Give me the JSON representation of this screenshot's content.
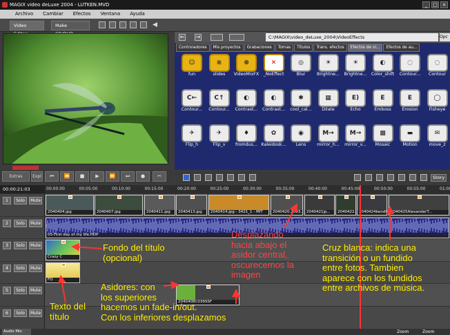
{
  "window": {
    "title": "MAGIX video deLuxe 2004 - LUTKEN.MVD"
  },
  "menu": [
    "Archivo",
    "Cambiar",
    "Efectos",
    "Ventana",
    "Ayuda"
  ],
  "toolbar": {
    "tab_video_editor": "Video Editor",
    "tab_make_cd": "Make CD/DVD"
  },
  "transport": {
    "export_label": "Expl",
    "extras_label": "Extras"
  },
  "browser": {
    "path": "C:\\MAGIX\\video_deLuxe_2004\\VideoEffects",
    "path_suffix": "Opc",
    "tabs": [
      "Controladores",
      "Mis proyectos",
      "Grabaciones",
      "Tomas",
      "Títulos",
      "Trans. efectos",
      "Efectos de vi...",
      "Efectos de au..."
    ],
    "effects": [
      "fun",
      "slides",
      "VideoMixFX",
      "_NoEffect",
      "Blur",
      "Brightne...",
      "Brightne...",
      "Color_shift",
      "Contour...",
      "Contour",
      "Contour...",
      "Contour...",
      "Contrast...",
      "Contrast...",
      "cool_cal...",
      "Dilate",
      "Echo",
      "Emboss",
      "Erosion",
      "Fisheye",
      "Flip_h",
      "Flip_v",
      "fromdus...",
      "Kaleidosk...",
      "Lens",
      "mirror_h...",
      "mirror_v...",
      "Mosaic",
      "Motion",
      "move_z"
    ],
    "story_label": "Story"
  },
  "timeline": {
    "timecode": "00:00:21:03",
    "ruler": [
      "00:00:00",
      "00:05:00",
      "00:10:00",
      "00:15:00",
      "00:20:00",
      "00:25:00",
      "00:30:00",
      "00:35:00",
      "00:40:00",
      "00:45:00",
      "00:50:00",
      "00:55:00",
      "01:00:00"
    ],
    "track_labels": {
      "solo": "Solo",
      "mute": "Mute"
    },
    "tracks": [
      "1",
      "2",
      "3",
      "4",
      "5",
      "6"
    ],
    "clips_track1": [
      "2040404.jpg",
      "2040407.jpg",
      "2040411.jpg",
      "2040413.jpg",
      "2040414.jpg - 3421_1 - MIT",
      "2040420.2003...",
      "2040421jp...",
      "2040422.jpg",
      "2040424bendt...",
      "2040425AlexanderT..."
    ],
    "audio_clip": "05-First day of my life.HDP",
    "title_clip_a": "Crazy C",
    "title_clip_b": "FO",
    "clip_track5": "2040408C039SSF",
    "status_zoom": "Zoom",
    "status_zoom2": "Zoom"
  },
  "annotations": {
    "fondo": "Fondo del título\n(opcional)",
    "texto": "Texto del\ntítulo",
    "asidores": "Asidores: con\nlos superiores\nhacemos un fade-in/out.\nCon los inferiores desplazamos",
    "desplazando": "Desplazando\nhacia abajo el\nasidor central,\noscurecemos la\nimagen",
    "cruz": "Cruz blanca: indica una\ntransición o un fundido\nentre fotos. Tambien\naparece con los fundidos\nentre archivos de música."
  }
}
